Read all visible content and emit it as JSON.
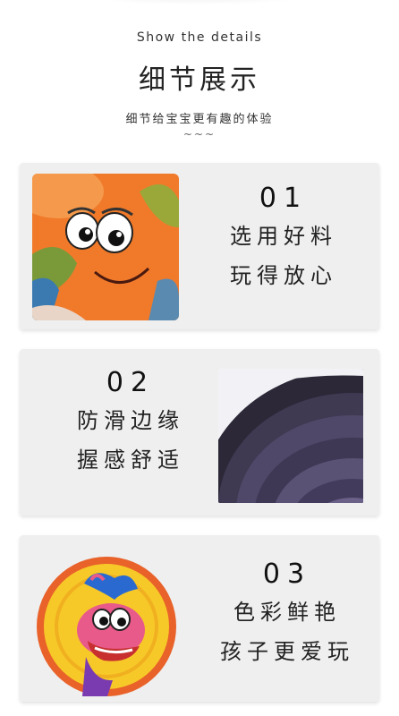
{
  "header": {
    "subtitle_en": "Show the details",
    "title_cn": "细节展示",
    "desc_cn": "细节给宝宝更有趣的体验",
    "squiggle": "~~~"
  },
  "cards": [
    {
      "number": "01",
      "line1": "选用好料",
      "line2": "玩得放心",
      "image": "orange-dinosaur-face-closeup"
    },
    {
      "number": "02",
      "line1": "防滑边缘",
      "line2": "握感舒适",
      "image": "purple-rim-closeup"
    },
    {
      "number": "03",
      "line1": "色彩鲜艳",
      "line2": "孩子更爱玩",
      "image": "colorful-dinosaur-disc"
    }
  ],
  "colors": {
    "card_bg": "#efefef",
    "text": "#1a1a1a",
    "orange": "#f07a2a",
    "purple": "#4a4460",
    "yellow": "#f7c928",
    "pink": "#e85a8a"
  }
}
